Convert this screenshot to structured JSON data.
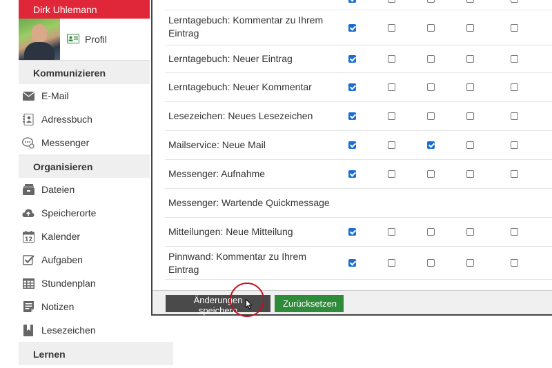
{
  "sidebar": {
    "user_name": "Dirk Uhlemann",
    "profile_label": "Profil",
    "sections": [
      {
        "title": "Kommunizieren",
        "items": [
          "E-Mail",
          "Adressbuch",
          "Messenger"
        ]
      },
      {
        "title": "Organisieren",
        "items": [
          "Dateien",
          "Speicherorte",
          "Kalender",
          "Aufgaben",
          "Stundenplan",
          "Notizen",
          "Lesezeichen"
        ]
      },
      {
        "title": "Lernen"
      }
    ]
  },
  "settings": {
    "rows": [
      {
        "label": "Lerntagebuch: Kommentar zu Ihrem Eintrag",
        "checks": [
          true,
          false,
          false,
          false,
          false
        ]
      },
      {
        "label": "Lerntagebuch: Neuer Eintrag",
        "checks": [
          true,
          false,
          false,
          false,
          false
        ]
      },
      {
        "label": "Lerntagebuch: Neuer Kommentar",
        "checks": [
          true,
          false,
          false,
          false,
          false
        ]
      },
      {
        "label": "Lesezeichen: Neues Lesezeichen",
        "checks": [
          true,
          false,
          false,
          false,
          false
        ]
      },
      {
        "label": "Mailservice: Neue Mail",
        "checks": [
          true,
          false,
          true,
          false,
          false
        ]
      },
      {
        "label": "Messenger: Aufnahme",
        "checks": [
          true,
          false,
          false,
          false,
          false
        ]
      },
      {
        "label": "Messenger: Wartende Quickmessage",
        "checks": []
      },
      {
        "label": "Mitteilungen: Neue Mitteilung",
        "checks": [
          true,
          false,
          false,
          false,
          false
        ]
      },
      {
        "label": "Pinnwand: Kommentar zu Ihrem Eintrag",
        "checks": [
          true,
          false,
          false,
          false,
          false
        ]
      }
    ]
  },
  "footer": {
    "save_label": "Änderungen speichern",
    "reset_label": "Zurücksetzen"
  },
  "colors": {
    "brand_red": "#e0273a",
    "check_blue": "#1a6fd4",
    "reset_green": "#2e8b3a"
  }
}
